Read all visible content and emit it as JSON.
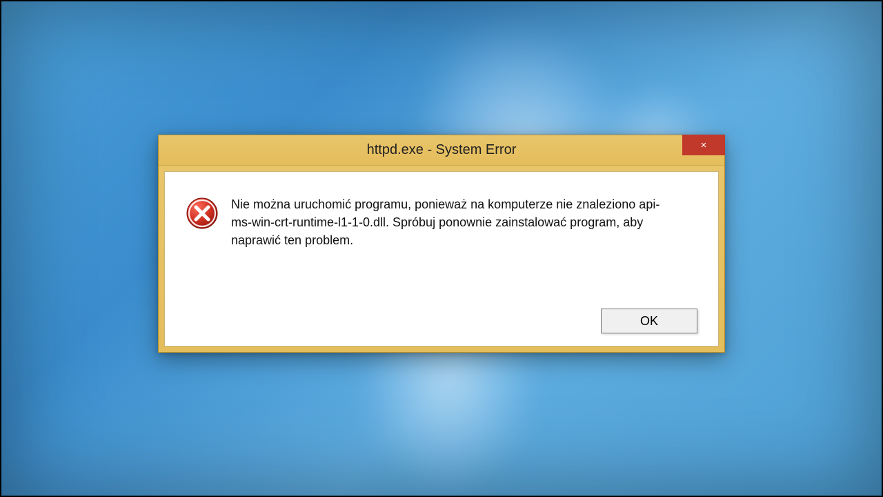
{
  "dialog": {
    "title": "httpd.exe - System Error",
    "message": "Nie można uruchomić programu, ponieważ na komputerze nie znaleziono api-ms-win-crt-runtime-l1-1-0.dll. Spróbuj ponownie zainstalować program, aby naprawić ten problem.",
    "ok_label": "OK",
    "close_label": "×"
  },
  "colors": {
    "titlebar": "#e4bd5c",
    "close": "#c0392b",
    "error_icon": "#d03224"
  }
}
